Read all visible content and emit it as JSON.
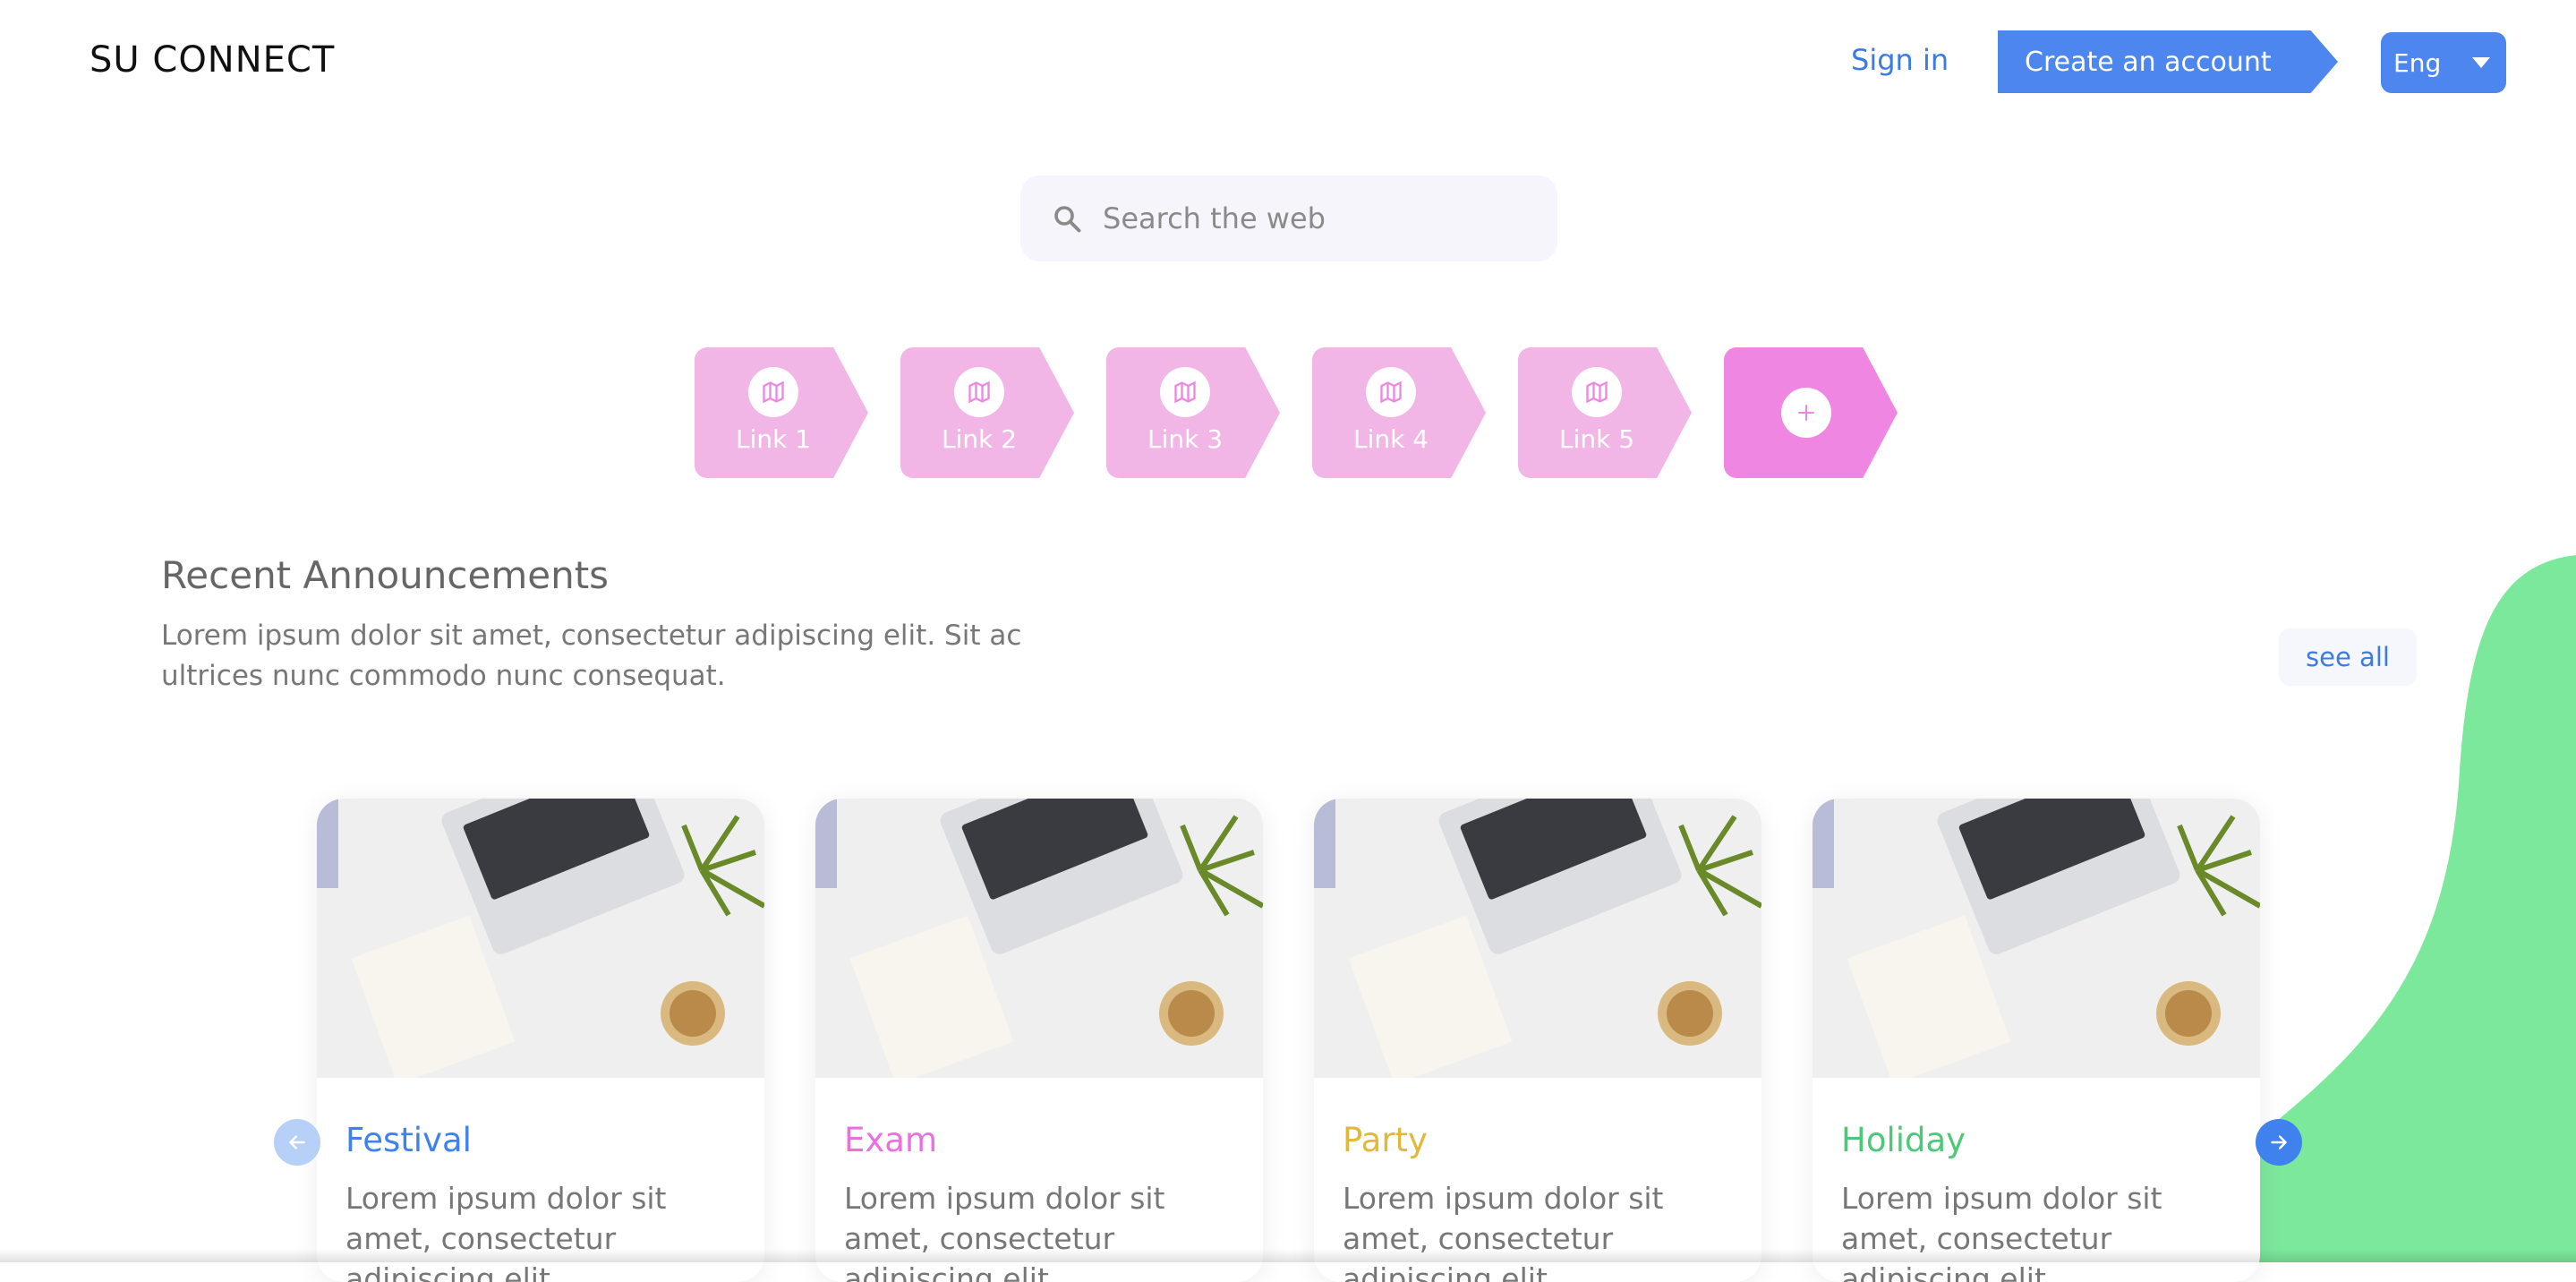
{
  "header": {
    "logo_text": "SU CONNECT",
    "sign_in": "Sign in",
    "create_account": "Create an account",
    "language": "Eng"
  },
  "search": {
    "placeholder": "Search the web",
    "value": ""
  },
  "links": [
    {
      "label": "Link 1",
      "icon": "map-icon"
    },
    {
      "label": "Link 2",
      "icon": "map-icon"
    },
    {
      "label": "Link 3",
      "icon": "map-icon"
    },
    {
      "label": "Link 4",
      "icon": "map-icon"
    },
    {
      "label": "Link 5",
      "icon": "map-icon"
    },
    {
      "label": "",
      "icon": "plus-icon"
    }
  ],
  "announcements": {
    "title": "Recent Announcements",
    "description": "Lorem ipsum dolor sit amet, consectetur adipiscing elit. Sit ac ultrices nunc commodo nunc consequat.",
    "see_all": "see all",
    "cards": [
      {
        "title": "Festival",
        "color": "#3f82ee",
        "body": "Lorem ipsum dolor sit amet, consectetur adipiscing elit,"
      },
      {
        "title": "Exam",
        "color": "#ec6fe0",
        "body": "Lorem ipsum dolor sit amet, consectetur adipiscing elit,"
      },
      {
        "title": "Party",
        "color": "#e2b83a",
        "body": "Lorem ipsum dolor sit amet, consectetur adipiscing elit,"
      },
      {
        "title": "Holiday",
        "color": "#4cc879",
        "body": "Lorem ipsum dolor sit amet, consectetur adipiscing elit,"
      }
    ]
  },
  "colors": {
    "accent": "#4c86ee",
    "tile_pink": "#f2b6e6",
    "tile_add": "#ef86e2",
    "blob_green": "#7ce89c"
  }
}
